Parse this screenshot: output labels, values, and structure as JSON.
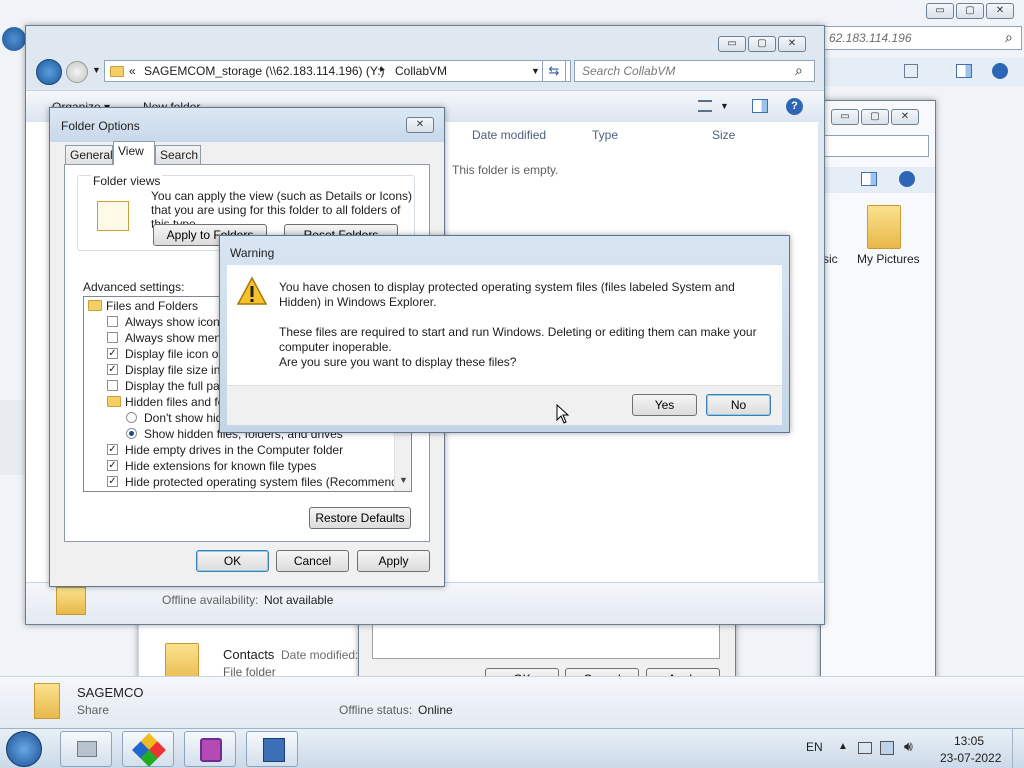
{
  "background_window": {
    "address": "62.183.114.196",
    "glyph_search": "⌕"
  },
  "explorer_window": {
    "breadcrumb_prefix": "«",
    "breadcrumb": "SAGEMCOM_storage (\\\\62.183.114.196) (Y:)",
    "breadcrumb_arrow": "▸",
    "breadcrumb_current": "CollabVM",
    "search_placeholder": "Search CollabVM",
    "organize": "Organize ▾",
    "new_folder": "New folder",
    "columns": [
      "Date modified",
      "Type",
      "Size"
    ],
    "empty_message": "This folder is empty.",
    "offline_label": "Offline availability:",
    "offline_value": "Not available"
  },
  "right_window": {
    "partial_label": "sic",
    "my_pictures": "My Pictures"
  },
  "lower_window": {
    "contacts_name": "Contacts",
    "contacts_date_label": "Date modified:",
    "contacts_type": "File folder",
    "ok": "OK",
    "cancel": "Cancel",
    "apply": "Apply"
  },
  "status_bar": {
    "share_name": "SAGEMCO",
    "share_type": "Share",
    "offline_status_label": "Offline status:",
    "offline_status_value": "Online"
  },
  "folder_options": {
    "title": "Folder Options",
    "tabs": [
      "General",
      "View",
      "Search"
    ],
    "folder_views_title": "Folder views",
    "folder_views_text": "You can apply the view (such as Details or Icons) that you are using for this folder to all folders of this type.",
    "apply_to_folders": "Apply to Folders",
    "reset_folders": "Reset Folders",
    "advanced_title": "Advanced settings:",
    "tree": [
      {
        "label": "Files and Folders",
        "kind": "folder",
        "indent": 0
      },
      {
        "label": "Always show icons, never thumbnails",
        "kind": "checkbox",
        "checked": false,
        "indent": 1
      },
      {
        "label": "Always show menus",
        "kind": "checkbox",
        "checked": false,
        "indent": 1
      },
      {
        "label": "Display file icon on thumbnails",
        "kind": "checkbox",
        "checked": true,
        "indent": 1
      },
      {
        "label": "Display file size information in folder tips",
        "kind": "checkbox",
        "checked": true,
        "indent": 1
      },
      {
        "label": "Display the full path in the title bar",
        "kind": "checkbox",
        "checked": false,
        "indent": 1
      },
      {
        "label": "Hidden files and folders",
        "kind": "folder",
        "indent": 1
      },
      {
        "label": "Don't show hidden files, folders, or drives",
        "kind": "radio",
        "checked": false,
        "indent": 2
      },
      {
        "label": "Show hidden files, folders, and drives",
        "kind": "radio",
        "checked": true,
        "indent": 2
      },
      {
        "label": "Hide empty drives in the Computer folder",
        "kind": "checkbox",
        "checked": true,
        "indent": 1
      },
      {
        "label": "Hide extensions for known file types",
        "kind": "checkbox",
        "checked": true,
        "indent": 1
      },
      {
        "label": "Hide protected operating system files (Recommended)",
        "kind": "checkbox",
        "checked": true,
        "indent": 1
      }
    ],
    "restore_defaults": "Restore Defaults",
    "ok": "OK",
    "cancel": "Cancel",
    "apply": "Apply",
    "check_glyph": "✓"
  },
  "warning_dialog": {
    "title": "Warning",
    "line1": "You have chosen to display protected operating system files (files labeled System and",
    "line2": "Hidden) in Windows Explorer.",
    "line3": "These files are required to start and run Windows. Deleting or editing them can make your",
    "line4": "computer inoperable.",
    "line5": "Are you sure you want to display these files?",
    "yes": "Yes",
    "no": "No",
    "warning_glyph": "!"
  },
  "taskbar": {
    "language": "EN",
    "time": "13:05",
    "date": "23-07-2022"
  },
  "caption_glyphs": {
    "minimize": "▭",
    "maximize": "▢",
    "close": "✕"
  },
  "colors": {
    "taskbar": "#dbe6f1",
    "accent": "#3c7fb1"
  }
}
